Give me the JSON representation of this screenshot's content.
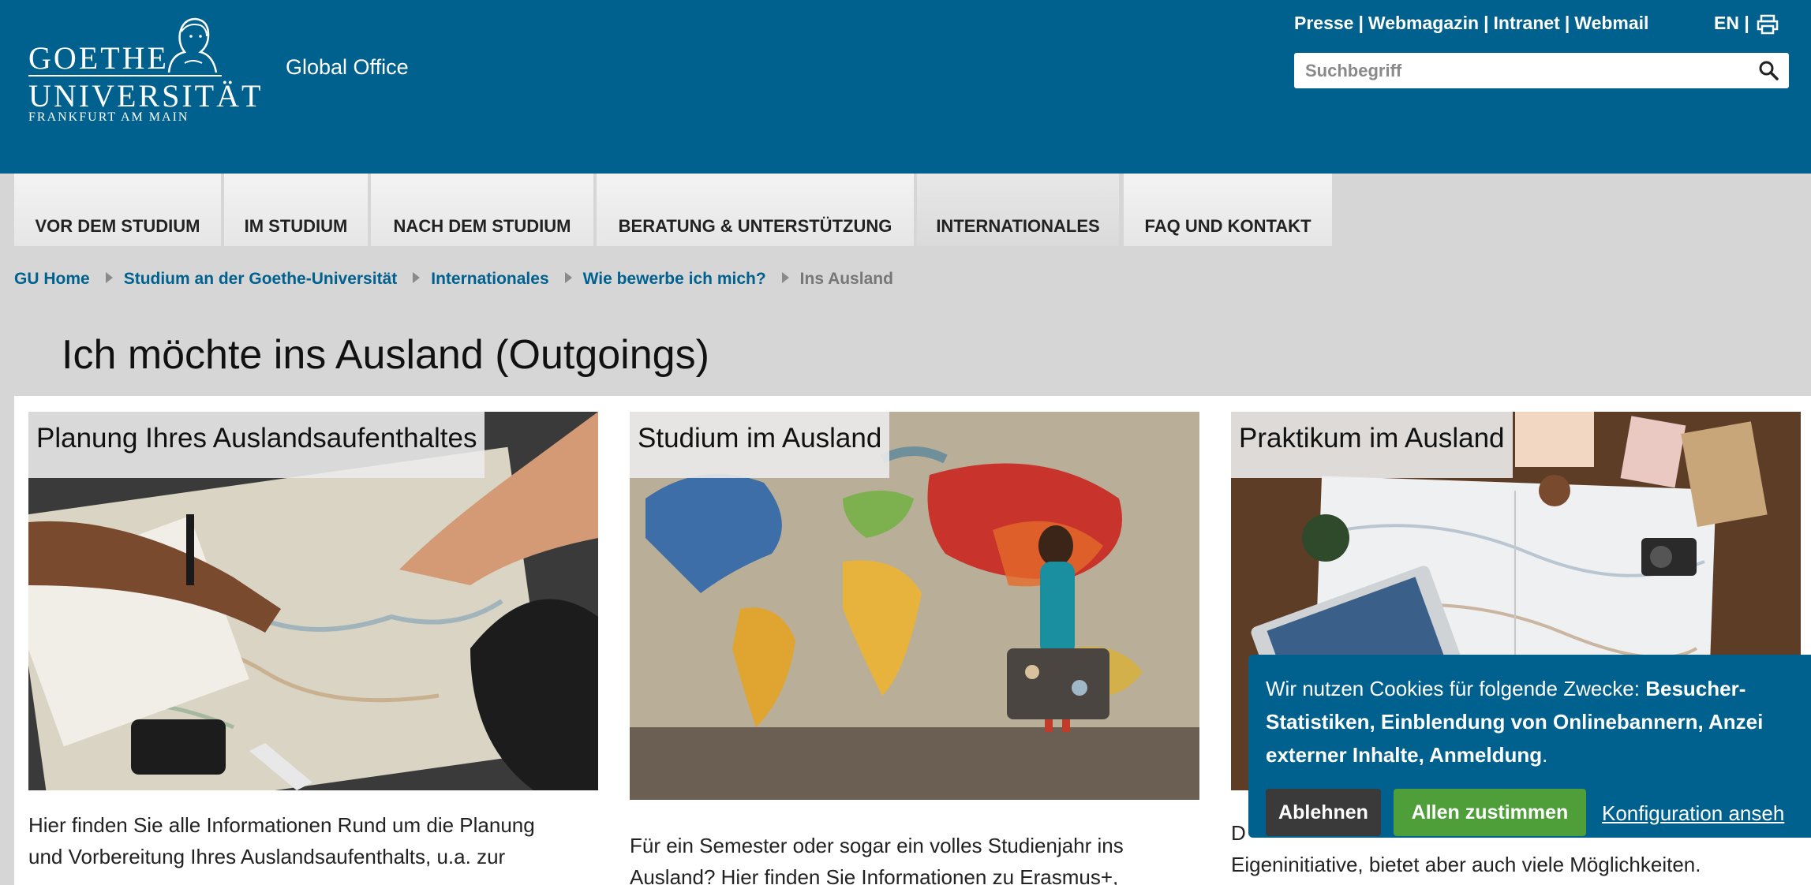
{
  "header": {
    "logo": {
      "line1": "GOETHE",
      "line2": "UNIVERSITÄT",
      "line3": "FRANKFURT AM MAIN"
    },
    "site_name": "Global Office",
    "top_links": [
      "Presse",
      "Webmagazin",
      "Intranet",
      "Webmail"
    ],
    "link_separator": "|",
    "language": "EN |",
    "search": {
      "placeholder": "Suchbegriff",
      "value": ""
    }
  },
  "nav": {
    "tabs": [
      {
        "label": "VOR DEM STUDIUM"
      },
      {
        "label": "IM STUDIUM"
      },
      {
        "label": "NACH DEM STUDIUM"
      },
      {
        "label": "BERATUNG & UNTERSTÜTZUNG"
      },
      {
        "label": "INTERNATIONALES",
        "active": true
      },
      {
        "label": "FAQ UND KONTAKT"
      }
    ]
  },
  "breadcrumb": {
    "items": [
      "GU Home",
      "Studium an der Goethe-Universität",
      "Internationales",
      "Wie bewerbe ich mich?"
    ],
    "current": "Ins Ausland"
  },
  "page": {
    "title": "Ich möchte ins Ausland (Outgoings)"
  },
  "cards": [
    {
      "title": "Planung Ihres Auslandsaufenthaltes",
      "text_lines": [
        "Hier finden Sie alle Informationen Rund um die Planung",
        "und Vorbereitung Ihres Auslandsaufenthalts, u.a. zur"
      ]
    },
    {
      "title": "Studium im Ausland",
      "text_lines": [
        "Für ein Semester oder sogar ein volles Studienjahr ins",
        "Ausland? Hier finden Sie Informationen zu Erasmus+,"
      ]
    },
    {
      "title": "Praktikum im Ausland",
      "text_lines": [
        "D",
        "Eigeninitiative, bietet aber auch viele Möglichkeiten."
      ]
    }
  ],
  "cookie_banner": {
    "intro": "Wir nutzen Cookies für folgende Zwecke: ",
    "purposes_line1": "Besucher-",
    "purposes_line2": "Statistiken, Einblendung von Onlinebannern, Anzei",
    "purposes_line3": "externer Inhalte, Anmeldung",
    "end": ".",
    "decline_label": "Ablehnen",
    "accept_label": "Allen zustimmen",
    "config_label": "Konfiguration anseh"
  },
  "colors": {
    "brand": "#00618f",
    "accept": "#4e9e39",
    "decline": "#3a3a3a"
  }
}
